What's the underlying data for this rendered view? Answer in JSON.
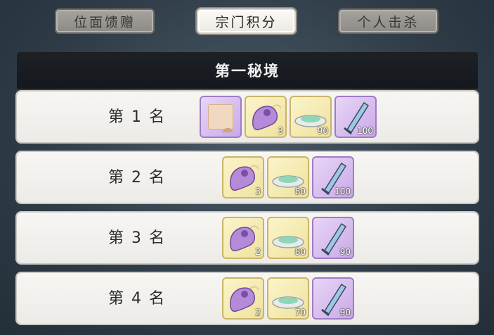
{
  "tabs": [
    {
      "label": "位面馈赠",
      "active": false
    },
    {
      "label": "宗门积分",
      "active": true
    },
    {
      "label": "个人击杀",
      "active": false
    }
  ],
  "panel": {
    "title": "第一秘境"
  },
  "rows": [
    {
      "rank": "第 1 名",
      "items": [
        {
          "icon": "frame-icon",
          "rarity": "purple",
          "qty": ""
        },
        {
          "icon": "spirit-beast-icon",
          "rarity": "gold",
          "qty": "3"
        },
        {
          "icon": "jade-dish-icon",
          "rarity": "gold",
          "qty": "90"
        },
        {
          "icon": "sword-icon",
          "rarity": "purple",
          "qty": "100"
        }
      ]
    },
    {
      "rank": "第 2 名",
      "items": [
        {
          "icon": "spirit-beast-icon",
          "rarity": "gold",
          "qty": "3"
        },
        {
          "icon": "jade-dish-icon",
          "rarity": "gold",
          "qty": "80"
        },
        {
          "icon": "sword-icon",
          "rarity": "purple",
          "qty": "100"
        }
      ]
    },
    {
      "rank": "第 3 名",
      "items": [
        {
          "icon": "spirit-beast-icon",
          "rarity": "gold",
          "qty": "2"
        },
        {
          "icon": "jade-dish-icon",
          "rarity": "gold",
          "qty": "80"
        },
        {
          "icon": "sword-icon",
          "rarity": "purple",
          "qty": "90"
        }
      ]
    },
    {
      "rank": "第 4 名",
      "items": [
        {
          "icon": "spirit-beast-icon",
          "rarity": "gold",
          "qty": "2"
        },
        {
          "icon": "jade-dish-icon",
          "rarity": "gold",
          "qty": "70"
        },
        {
          "icon": "sword-icon",
          "rarity": "purple",
          "qty": "90"
        }
      ]
    }
  ],
  "colors": {
    "gold_item": "#efe29e",
    "purple_item": "#c9a9e8"
  }
}
